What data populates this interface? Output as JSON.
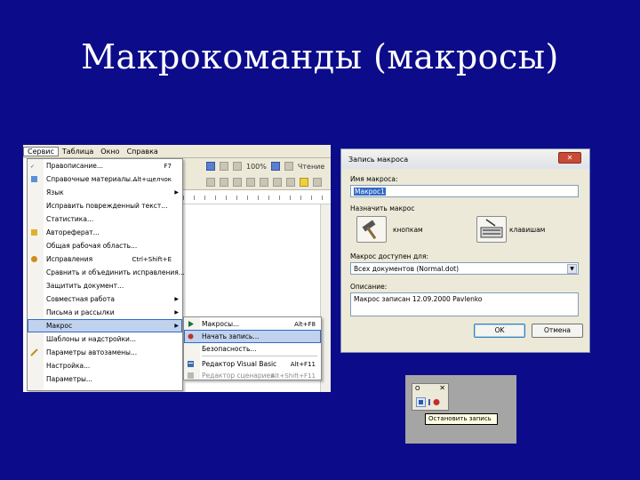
{
  "slide": {
    "title": "Макрокоманды (макросы)"
  },
  "word": {
    "menubar": [
      "Сервис",
      "Таблица",
      "Окно",
      "Справка"
    ],
    "toolbar": {
      "zoom": "100%",
      "style_label": "Чтение"
    },
    "menu_items": [
      {
        "label": "Правописание...",
        "key": "F7",
        "icon": "spellcheck-icon"
      },
      {
        "label": "Справочные материалы...",
        "key": "Alt+щелчок",
        "icon": "research-icon"
      },
      {
        "label": "Язык",
        "key": "",
        "submenu": true
      },
      {
        "label": "Исправить поврежденный текст...",
        "key": ""
      },
      {
        "label": "Статистика...",
        "key": ""
      },
      {
        "label": "Автореферат...",
        "key": "",
        "icon": "autosummary-icon"
      },
      {
        "label": "Общая рабочая область...",
        "key": ""
      },
      {
        "label": "Исправления",
        "key": "Ctrl+Shift+E",
        "icon": "track-changes-icon"
      },
      {
        "label": "Сравнить и объединить исправления...",
        "key": ""
      },
      {
        "label": "Защитить документ...",
        "key": ""
      },
      {
        "label": "Совместная работа",
        "key": "",
        "submenu": true
      },
      {
        "label": "Письма и рассылки",
        "key": "",
        "submenu": true
      },
      {
        "label": "Макрос",
        "key": "",
        "submenu": true,
        "highlighted": true
      },
      {
        "label": "Шаблоны и надстройки...",
        "key": ""
      },
      {
        "label": "Параметры автозамены...",
        "key": "",
        "icon": "autocorrect-icon"
      },
      {
        "label": "Настройка...",
        "key": ""
      },
      {
        "label": "Параметры...",
        "key": ""
      }
    ],
    "submenu_items": [
      {
        "label": "Макросы...",
        "key": "Alt+F8",
        "icon": "play-icon"
      },
      {
        "label": "Начать запись...",
        "key": "",
        "icon": "record-icon",
        "highlighted": true
      },
      {
        "label": "Безопасность...",
        "key": ""
      },
      {
        "label": "Редактор Visual Basic",
        "key": "Alt+F11",
        "icon": "vba-editor-icon"
      },
      {
        "label": "Редактор сценариев",
        "key": "Alt+Shift+F11",
        "icon": "script-editor-icon",
        "disabled": true
      }
    ]
  },
  "dialog": {
    "title": "Запись макроса",
    "close_label": "✕",
    "macro_name_label": "Имя макроса:",
    "macro_name_value": "Макрос1",
    "assign_label": "Назначить макрос",
    "assign_buttons_label": "кнопкам",
    "assign_keys_label": "клавишам",
    "available_for_label": "Макрос доступен для:",
    "available_for_value": "Всех документов (Normal.dot)",
    "description_label": "Описание:",
    "description_value": "Макрос записан 12.09.2000 Pavlenko",
    "ok_label": "OK",
    "cancel_label": "Отмена"
  },
  "stop_toolbar": {
    "title": "О",
    "close_label": "✕",
    "tooltip": "Остановить запись"
  }
}
